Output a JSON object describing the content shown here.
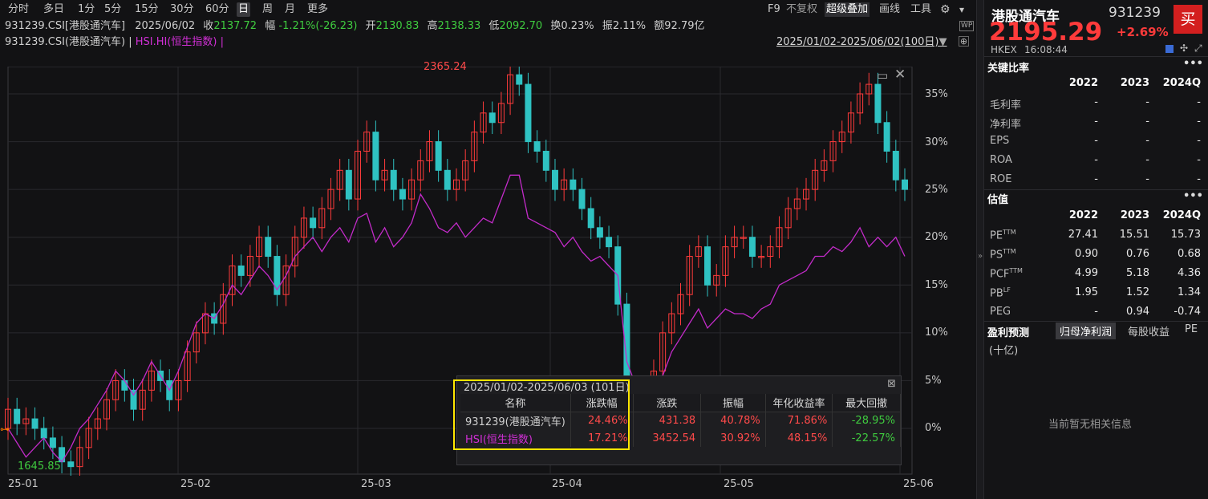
{
  "toolbar": {
    "periods": [
      "分时",
      "多日",
      "1分",
      "5分",
      "15分",
      "30分",
      "60分",
      "日",
      "周",
      "月",
      "更多"
    ],
    "active_period": "日",
    "right_tools": [
      "F9",
      "不复权",
      "超级叠加",
      "画线",
      "工具"
    ]
  },
  "info_line": {
    "code": "931239.CSI[港股通汽车]",
    "date": "2025/06/02",
    "close_label": "收",
    "close": "2137.72",
    "change_label": "幅",
    "change": "-1.21%(-26.23)",
    "open_label": "开",
    "open": "2130.83",
    "high_label": "高",
    "high": "2138.33",
    "low_label": "低",
    "low": "2092.70",
    "turnover_label": "换",
    "turnover": "0.23%",
    "amplitude_label": "振",
    "amplitude": "2.11%",
    "amount_label": "额",
    "amount": "92.79亿"
  },
  "legend_line": {
    "main": "931239.CSI(港股通汽车)",
    "sep1": "|",
    "overlay": "HSI.HI(恒生指数)",
    "sep2": "|",
    "range": "2025/01/02-2025/06/02(100日)"
  },
  "chart": {
    "max_label": "2365.24",
    "min_label": "1645.85",
    "y_labels": [
      "35%",
      "30%",
      "25%",
      "20%",
      "15%",
      "10%",
      "5%",
      "0%"
    ],
    "x_labels": [
      "25-01",
      "25-02",
      "25-03",
      "25-04",
      "25-05",
      "25-06"
    ],
    "colors": {
      "up": "#ff3b3b",
      "down": "#2fc2c2",
      "overlay": "#c32bc9",
      "grid": "#2a2a2e"
    },
    "overlay_pct": [
      0,
      -1.5,
      -3,
      -2,
      -1,
      -2.5,
      -3.5,
      -2,
      0,
      1,
      2.5,
      4,
      6,
      5,
      3.5,
      5,
      7,
      5.5,
      4,
      6,
      8.5,
      11,
      12,
      11.5,
      13,
      15,
      14,
      15.5,
      17,
      16,
      14.5,
      16,
      18,
      19,
      20,
      18.5,
      20,
      21,
      19.5,
      22,
      22.5,
      19.5,
      21,
      19,
      20,
      21.5,
      24.5,
      23,
      21,
      20.5,
      21.5,
      20,
      21,
      22,
      21.5,
      24,
      26.5,
      26.5,
      22,
      21.5,
      21,
      20.5,
      19,
      20,
      18.5,
      17.5,
      18,
      17,
      16,
      7,
      4.5,
      3,
      5,
      5.5,
      8,
      9.5,
      11,
      12.5,
      10.5,
      11.5,
      12.5,
      12,
      12,
      11.5,
      12.5,
      13,
      15,
      15.5,
      16,
      16.5,
      18,
      18,
      19,
      18.5,
      19.5,
      21,
      19,
      20,
      19,
      20,
      18
    ]
  },
  "stats": {
    "header": "2025/01/02-2025/06/03 (101日)",
    "columns": [
      "名称",
      "涨跌幅",
      "涨跌",
      "振幅",
      "年化收益率",
      "最大回撤"
    ],
    "rows": [
      [
        "931239(港股通汽车)",
        "24.46%",
        "431.38",
        "40.78%",
        "71.86%",
        "-28.95%"
      ],
      [
        "HSI(恒生指数)",
        "17.21%",
        "3452.54",
        "30.92%",
        "48.15%",
        "-22.57%"
      ]
    ]
  },
  "quote": {
    "name": "港股通汽车",
    "code": "931239",
    "price": "2195.29",
    "change": "+2.69%",
    "market": "HKEX",
    "time": "16:08:44",
    "buy_label": "买"
  },
  "ratios": {
    "title": "关键比率",
    "years": [
      "2022",
      "2023",
      "2024Q"
    ],
    "rows": [
      [
        "毛利率",
        "-",
        "-",
        "-"
      ],
      [
        "净利率",
        "-",
        "-",
        "-"
      ],
      [
        "EPS",
        "-",
        "-",
        "-"
      ],
      [
        "ROA",
        "-",
        "-",
        "-"
      ],
      [
        "ROE",
        "-",
        "-",
        "-"
      ]
    ]
  },
  "valuation": {
    "title": "估值",
    "years": [
      "2022",
      "2023",
      "2024Q"
    ],
    "rows": [
      [
        "PE",
        "TTM",
        "27.41",
        "15.51",
        "15.73"
      ],
      [
        "PS",
        "TTM",
        "0.90",
        "0.76",
        "0.68"
      ],
      [
        "PCF",
        "TTM",
        "4.99",
        "5.18",
        "4.36"
      ],
      [
        "PB",
        "LF",
        "1.95",
        "1.52",
        "1.34"
      ],
      [
        "PEG",
        "",
        "-",
        "0.94",
        "-0.74"
      ]
    ]
  },
  "forecast": {
    "title": "盈利预测",
    "tabs": [
      "归母净利润",
      "每股收益",
      "PE"
    ],
    "unit": "(十亿)",
    "empty_text": "当前暂无相关信息"
  }
}
